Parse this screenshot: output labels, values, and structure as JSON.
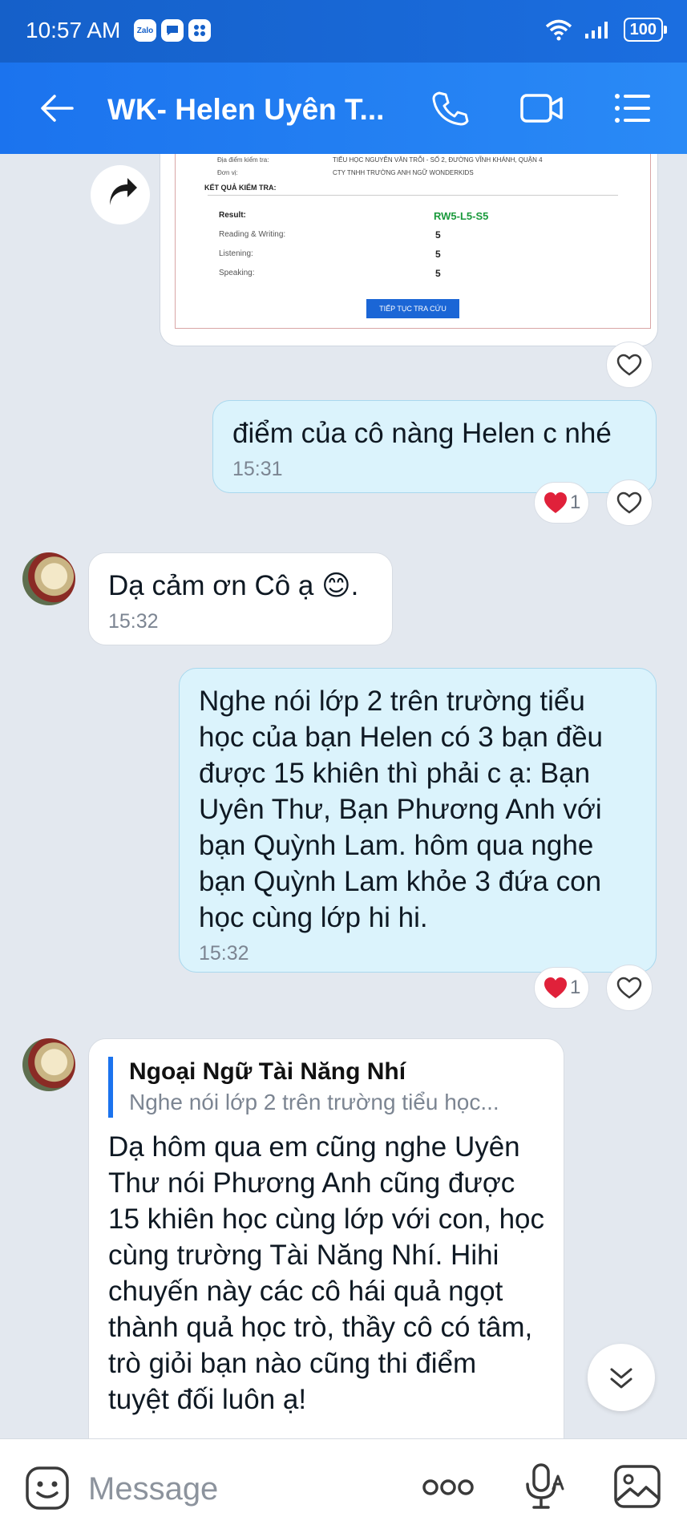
{
  "status_bar": {
    "time": "10:57 AM",
    "apps": [
      "Zalo",
      "chat",
      "grid"
    ],
    "battery": "100"
  },
  "header": {
    "title": "WK- Helen Uyên T...",
    "icons": [
      "back-arrow-icon",
      "phone-icon",
      "video-call-icon",
      "menu-list-icon"
    ]
  },
  "image_card": {
    "location_label": "Địa điểm kiểm tra:",
    "location_value": "TIỂU HỌC NGUYỄN VĂN TRỖI - SỐ 2, ĐƯỜNG VĨNH KHÁNH, QUẬN 4",
    "unit_label": "Đơn vị:",
    "unit_value": "CTY TNHH TRƯỜNG ANH NGỮ WONDERKIDS",
    "results_header": "KẾT QUẢ KIỂM TRA:",
    "rows": [
      {
        "label": "Result:",
        "value": "RW5-L5-S5"
      },
      {
        "label": "Reading & Writing:",
        "value": "5"
      },
      {
        "label": "Listening:",
        "value": "5"
      },
      {
        "label": "Speaking:",
        "value": "5"
      }
    ],
    "button": "TIẾP TỤC TRA CỨU"
  },
  "messages": [
    {
      "text": "điểm của cô nàng Helen c nhé",
      "time": "15:31",
      "reaction_count": "1"
    },
    {
      "text": "Dạ cảm ơn Cô ạ 😊.",
      "time": "15:32"
    },
    {
      "text": "Nghe nói lớp 2 trên trường tiểu học của bạn Helen có 3 bạn đều được 15 khiên thì phải c ạ: Bạn Uyên Thư, Bạn Phương Anh với bạn Quỳnh Lam. hôm qua nghe bạn Quỳnh Lam khỏe 3 đứa con học cùng lớp hi hi.",
      "time": "15:32",
      "reaction_count": "1"
    },
    {
      "quote_name": "Ngoại Ngữ Tài Năng Nhí",
      "quote_text": "Nghe nói lớp 2 trên trường tiểu học...",
      "text": "Dạ hôm qua em cũng nghe Uyên Thư nói Phương Anh cũng được 15 khiên học cùng lớp với con, học cùng trường Tài Năng Nhí. Hihi chuyến này các cô hái quả ngọt thành quả học trò, thầy cô có tâm, trò giỏi bạn nào cũng thi điểm tuyệt đối luôn ạ!"
    }
  ],
  "input": {
    "placeholder": "Message"
  },
  "colors": {
    "header": "#1b73ee",
    "outgoing_bubble": "#dbf3fc",
    "incoming_bubble": "#ffffff",
    "background": "#e3e8ef",
    "heart_red": "#e0213a"
  }
}
